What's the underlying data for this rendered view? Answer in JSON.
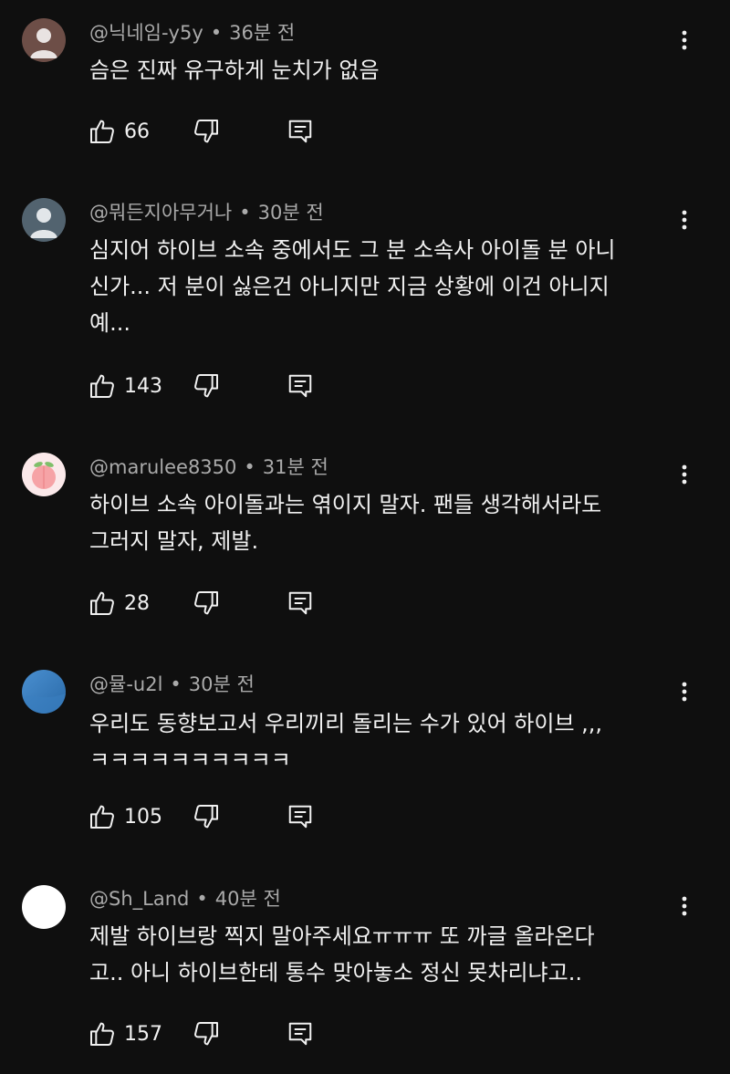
{
  "colors": {
    "background": "#0f0f0f",
    "text_primary": "#f1f1f1",
    "text_secondary": "#aaaaaa"
  },
  "comments": [
    {
      "author": "@닉네임-y5y",
      "time": "36분 전",
      "text": "슴은 진짜 유구하게 눈치가 없음",
      "likes": "66",
      "avatar": "default-avatar-brown"
    },
    {
      "author": "@뭐든지아무거나",
      "time": "30분 전",
      "text": "심지어 하이브 소속 중에서도 그 분 소속사 아이돌 분 아니\n신가... 저 분이 싫은건 아니지만 지금 상황에 이건 아니지\n예...",
      "likes": "143",
      "avatar": "default-avatar-slate"
    },
    {
      "author": "@marulee8350",
      "time": "31분 전",
      "text": "하이브 소속 아이돌과는 엮이지 말자. 팬들 생각해서라도\n그러지 말자, 제발.",
      "likes": "28",
      "avatar": "peach-avatar"
    },
    {
      "author": "@뮬-u2l",
      "time": "30분 전",
      "text": "우리도 동향보고서 우리끼리 돌리는 수가 있어 하이브 ,,,\nㅋㅋㅋㅋㅋㅋㅋㅋㅋㅋ",
      "likes": "105",
      "avatar": "blue-avatar"
    },
    {
      "author": "@Sh_Land",
      "time": "40분 전",
      "text": "제발 하이브랑 찍지 말아주세요ㅠㅠㅠ 또 까글 올라온다\n고.. 아니 하이브한테 통수 맞아놓소 정신 못차리냐고..",
      "likes": "157",
      "avatar": "white-avatar"
    }
  ]
}
